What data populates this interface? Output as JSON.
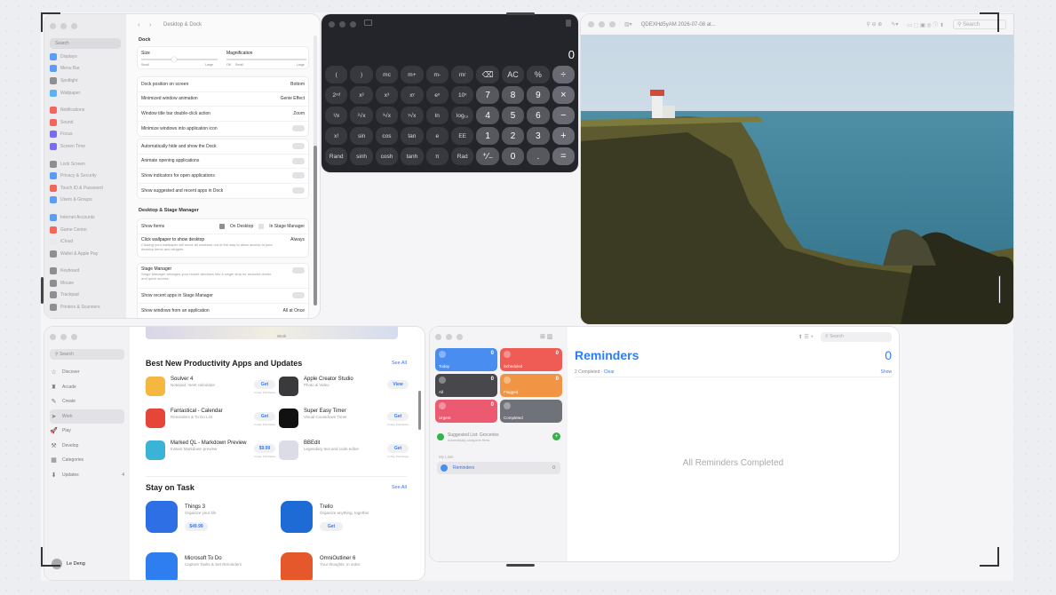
{
  "settings": {
    "title": "Desktop & Dock",
    "search_placeholder": "Search",
    "sidebar": [
      {
        "label": "Displays",
        "color": "#5b9cf5"
      },
      {
        "label": "Menu Bar",
        "color": "#5b9cf5"
      },
      {
        "label": "Spotlight",
        "color": "#8e8e93"
      },
      {
        "label": "Wallpaper",
        "color": "#58b3f5"
      },
      {
        "label": "Notifications",
        "color": "#f2665e"
      },
      {
        "label": "Sound",
        "color": "#f2665e"
      },
      {
        "label": "Focus",
        "color": "#7a6cf0"
      },
      {
        "label": "Screen Time",
        "color": "#7a6cf0"
      },
      {
        "label": "Lock Screen",
        "color": "#8e8e93"
      },
      {
        "label": "Privacy & Security",
        "color": "#5b9cf5"
      },
      {
        "label": "Touch ID & Password",
        "color": "#f2665e"
      },
      {
        "label": "Users & Groups",
        "color": "#5b9cf5"
      },
      {
        "label": "Internet Accounts",
        "color": "#5b9cf5"
      },
      {
        "label": "Game Center",
        "color": "#f2665e"
      },
      {
        "label": "iCloud",
        "color": "#e8e8ee"
      },
      {
        "label": "Wallet & Apple Pay",
        "color": "#8e8e93"
      },
      {
        "label": "Keyboard",
        "color": "#8e8e93"
      },
      {
        "label": "Mouse",
        "color": "#8e8e93"
      },
      {
        "label": "Trackpad",
        "color": "#8e8e93"
      },
      {
        "label": "Printers & Scanners",
        "color": "#8e8e93"
      }
    ],
    "dock_section": "Dock",
    "size_label": "Size",
    "magnification_label": "Magnification",
    "small": "Small",
    "large": "Large",
    "off": "Off",
    "rows": [
      {
        "label": "Dock position on screen",
        "value": "Bottom"
      },
      {
        "label": "Minimized window animation",
        "value": "Genie Effect"
      },
      {
        "label": "Window title bar double-click action",
        "value": "Zoom"
      },
      {
        "label": "Minimize windows into application icon",
        "value": ""
      },
      {
        "label": "Automatically hide and show the Dock",
        "value": ""
      },
      {
        "label": "Animate opening applications",
        "value": ""
      },
      {
        "label": "Show indicators for open applications",
        "value": ""
      },
      {
        "label": "Show suggested and recent apps in Dock",
        "value": ""
      }
    ],
    "stage_section": "Desktop & Stage Manager",
    "show_items": "Show Items",
    "on_desktop": "On Desktop",
    "in_stage_manager": "In Stage Manager",
    "click_wallpaper": "Click wallpaper to show desktop",
    "click_wallpaper_value": "Always",
    "click_wallpaper_sub": "Clicking your wallpaper will move all windows out of the way to allow access to your desktop items and widgets.",
    "stage_manager": "Stage Manager",
    "stage_manager_sub": "Stage Manager arranges your recent windows into a single strip for reduced clutter and quick access.",
    "show_recent": "Show recent apps in Stage Manager",
    "show_windows": "Show windows from an application",
    "show_windows_value": "All at Once"
  },
  "calculator": {
    "display": "0",
    "keys": [
      "(",
      ")",
      "mc",
      "m+",
      "m-",
      "mr",
      "⌫",
      "AC",
      "%",
      "÷",
      "2ⁿᵈ",
      "x²",
      "x³",
      "xʸ",
      "eˣ",
      "10ˣ",
      "7",
      "8",
      "9",
      "×",
      "¹/x",
      "²√x",
      "³√x",
      "ʸ√x",
      "ln",
      "log₁₀",
      "4",
      "5",
      "6",
      "−",
      "x!",
      "sin",
      "cos",
      "tan",
      "e",
      "EE",
      "1",
      "2",
      "3",
      "+",
      "Rand",
      "sinh",
      "cosh",
      "tanh",
      "π",
      "Rad",
      "⁺∕₋",
      "0",
      ".",
      "="
    ]
  },
  "preview": {
    "title": "QDEXHd5yAM 2026-07-08 at...",
    "search": "Search"
  },
  "appstore": {
    "search": "Search",
    "top_label": "Work",
    "sidebar": [
      {
        "label": "Discover",
        "icon": "☆"
      },
      {
        "label": "Arcade",
        "icon": "♜"
      },
      {
        "label": "Create",
        "icon": "✎"
      },
      {
        "label": "Work",
        "icon": "➤"
      },
      {
        "label": "Play",
        "icon": "🚀"
      },
      {
        "label": "Develop",
        "icon": "⚒"
      },
      {
        "label": "Categories",
        "icon": "▦"
      },
      {
        "label": "Updates",
        "icon": "⬇",
        "badge": "4"
      }
    ],
    "user": "Le Deng",
    "section1": "Best New Productivity Apps and Updates",
    "see_all": "See All",
    "apps": [
      {
        "name": "Soulver 4",
        "desc": "Notepad, meet calculator",
        "btn": "Get",
        "color": "#f5b740"
      },
      {
        "name": "Apple Creator Studio",
        "desc": "Photo & Video",
        "btn": "View",
        "color": "#3a3a3c"
      },
      {
        "name": "Fantastical - Calendar",
        "desc": "Reminders & To Do List",
        "btn": "Get",
        "color": "#e6453a"
      },
      {
        "name": "Super Easy Timer",
        "desc": "Visual Countdown Timer",
        "btn": "Get",
        "color": "#111"
      },
      {
        "name": "Marked QL - Markdown Preview",
        "desc": "Instant Markdown preview",
        "btn": "$9.99",
        "color": "#3bb3d6"
      },
      {
        "name": "BBEdit",
        "desc": "Legendary text and code editor",
        "btn": "Get",
        "color": "#dcdce6"
      }
    ],
    "in_app": "In-App Purchases",
    "section2": "Stay on Task",
    "big_apps": [
      {
        "name": "Things 3",
        "desc": "Organize your life",
        "btn": "$49.99",
        "color": "#2e6fe6"
      },
      {
        "name": "Trello",
        "desc": "Organize anything, together",
        "btn": "Get",
        "color": "#1f6bd6"
      },
      {
        "name": "Microsoft To Do",
        "desc": "Capture Tasks & Set Reminders",
        "btn": "",
        "color": "#2e7ef0"
      },
      {
        "name": "OmniOutliner 6",
        "desc": "Your thoughts, in order.",
        "btn": "",
        "color": "#e5582c"
      }
    ]
  },
  "reminders": {
    "search": "Search",
    "title": "Reminders",
    "count": "0",
    "completed": "2 Completed",
    "clear": "Clear",
    "show": "Show",
    "empty": "All Reminders Completed",
    "tiles": [
      {
        "label": "Today",
        "count": "0",
        "color": "#4a8df0"
      },
      {
        "label": "Scheduled",
        "count": "0",
        "color": "#ef5b55"
      },
      {
        "label": "All",
        "count": "0",
        "color": "#48484c"
      },
      {
        "label": "Flagged",
        "count": "0",
        "color": "#f19545"
      },
      {
        "label": "Urgent",
        "count": "0",
        "color": "#ec5a72"
      },
      {
        "label": "Completed",
        "count": "",
        "color": "#6f7278"
      }
    ],
    "suggested": "Suggested List: Groceries",
    "suggested_sub": "Automatically categorize items",
    "my_lists": "My Lists",
    "list_name": "Reminders",
    "list_count": "0"
  }
}
